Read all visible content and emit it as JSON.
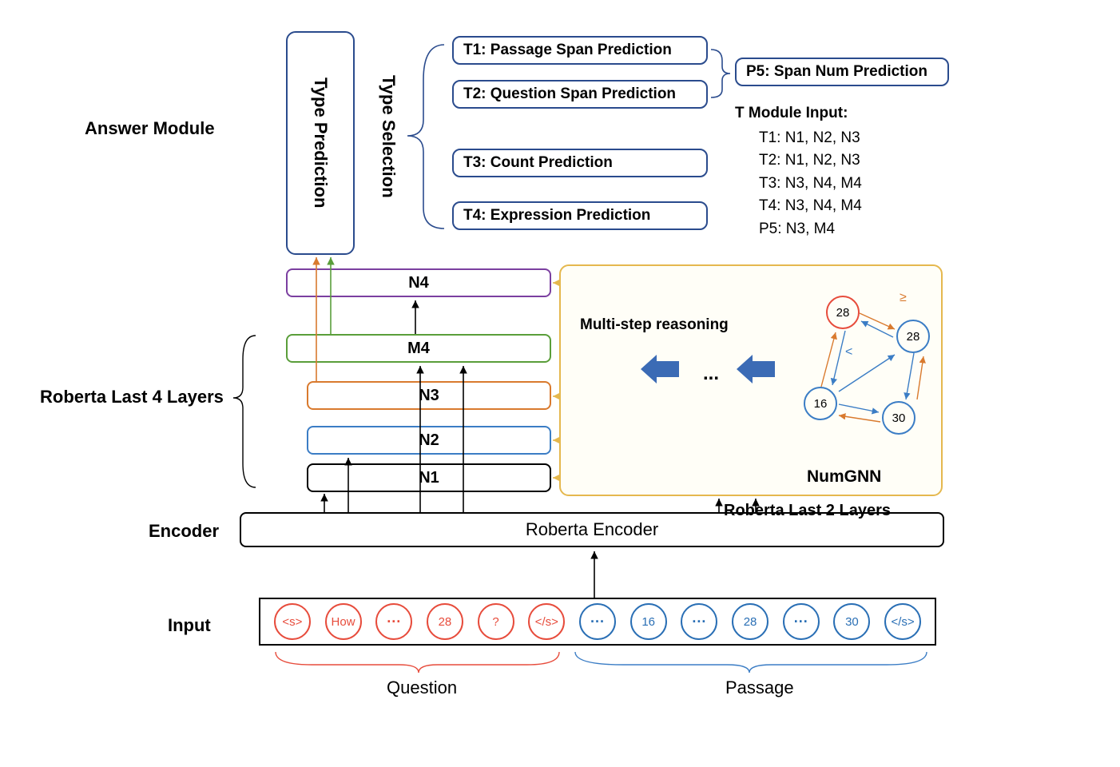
{
  "sections": {
    "answer_module": "Answer Module",
    "roberta_last4": "Roberta Last 4 Layers",
    "encoder": "Encoder",
    "input": "Input"
  },
  "input_tokens": {
    "question": [
      "<s>",
      "How",
      "···",
      "28",
      "?",
      "</s>"
    ],
    "passage": [
      "···",
      "16",
      "···",
      "28",
      "···",
      "30",
      "</s>"
    ]
  },
  "encoder_label": "Roberta Encoder",
  "layers": {
    "n1": "N1",
    "n2": "N2",
    "n3": "N3",
    "m4": "M4",
    "n4": "N4"
  },
  "type_prediction": "Type Prediction",
  "type_selection": "Type Selection",
  "tasks": {
    "t1": "T1: Passage Span Prediction",
    "t2": "T2: Question Span Prediction",
    "t3": "T3: Count Prediction",
    "t4": "T4: Expression Prediction",
    "p5": "P5: Span Num Prediction"
  },
  "tinput": {
    "title": "T Module Input:",
    "items": [
      "T1: N1, N2, N3",
      "T2: N1, N2, N3",
      "T3: N3, N4, M4",
      "T4: N3, N4, M4",
      "P5: N3, M4"
    ]
  },
  "gnn": {
    "label": "NumGNN",
    "roberta2": "Roberta Last 2 Layers",
    "multistep": "Multi-step reasoning",
    "nodes": {
      "n1": "28",
      "n2": "28",
      "n3": "30",
      "n4": "16"
    },
    "ge": "≥",
    "lt": "<"
  },
  "groups": {
    "question": "Question",
    "passage": "Passage"
  },
  "dots": "..."
}
